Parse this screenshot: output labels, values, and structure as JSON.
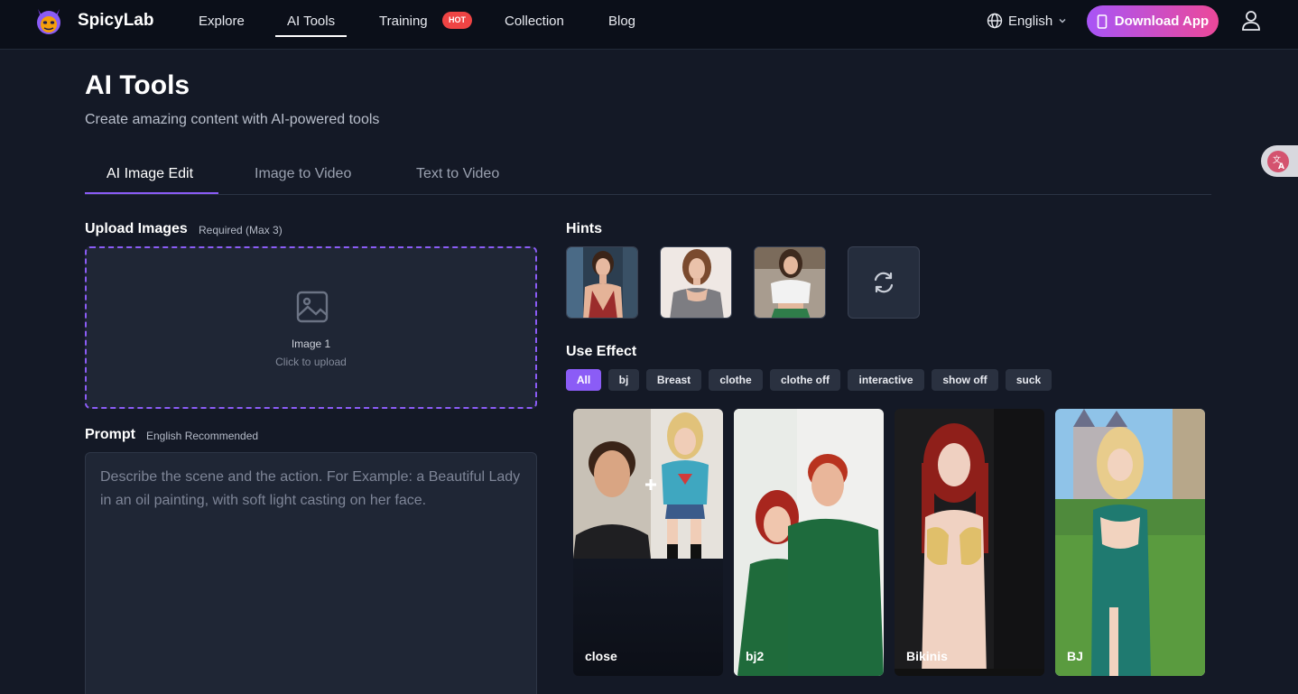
{
  "header": {
    "brand": "SpicyLab",
    "nav": [
      {
        "label": "Explore"
      },
      {
        "label": "AI Tools"
      },
      {
        "label": "Training"
      },
      {
        "label": "Collection"
      },
      {
        "label": "Blog"
      }
    ],
    "hot_badge": "HOT",
    "language": "English",
    "download_label": "Download App"
  },
  "page": {
    "title": "AI Tools",
    "subtitle": "Create amazing content with AI-powered tools"
  },
  "tabs": [
    {
      "label": "AI Image Edit"
    },
    {
      "label": "Image to Video"
    },
    {
      "label": "Text to Video"
    }
  ],
  "upload": {
    "title": "Upload Images",
    "note": "Required (Max 3)",
    "slot_label": "Image 1",
    "slot_hint": "Click to upload"
  },
  "prompt": {
    "title": "Prompt",
    "note": "English Recommended",
    "placeholder": "Describe the scene and the action. For Example: a Beautiful Lady in an oil painting, with soft light casting on her face."
  },
  "hints": {
    "title": "Hints"
  },
  "effects": {
    "title": "Use Effect",
    "filters": [
      "All",
      "bj",
      "Breast",
      "clothe",
      "clothe off",
      "interactive",
      "show off",
      "suck"
    ],
    "cards": [
      {
        "title": "close"
      },
      {
        "title": "bj2"
      },
      {
        "title": "Bikinis"
      },
      {
        "title": "BJ"
      }
    ]
  },
  "colors": {
    "accent": "#8b5cf6",
    "hot": "#ef4444",
    "background": "#141926"
  }
}
